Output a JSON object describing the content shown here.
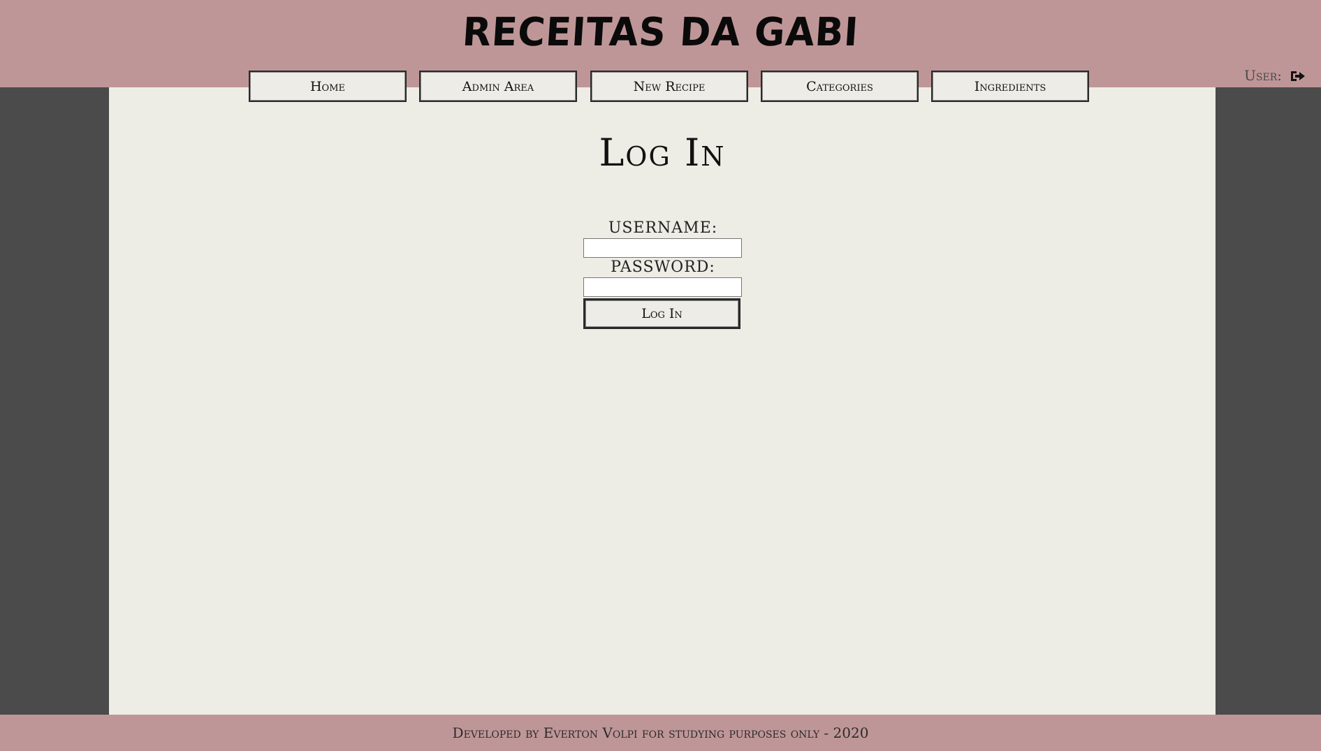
{
  "header": {
    "site_title": "RECEITAS DA GABI"
  },
  "nav": {
    "items": [
      {
        "label": "Home"
      },
      {
        "label": "Admin Area"
      },
      {
        "label": "New Recipe"
      },
      {
        "label": "Categories"
      },
      {
        "label": "Ingredients"
      }
    ]
  },
  "user": {
    "label": "User:",
    "logout_icon": "sign-out-icon"
  },
  "main": {
    "title": "Log In",
    "form": {
      "username_label": "USERNAME:",
      "username_value": "",
      "password_label": "PASSWORD:",
      "password_value": "",
      "submit_label": "Log In"
    }
  },
  "footer": {
    "text": "Developed by Everton Volpi for studying purposes only - 2020"
  },
  "colors": {
    "header_bg": "#bf9697",
    "sidebar_bg": "#4b4b4b",
    "content_bg": "#edece5"
  }
}
